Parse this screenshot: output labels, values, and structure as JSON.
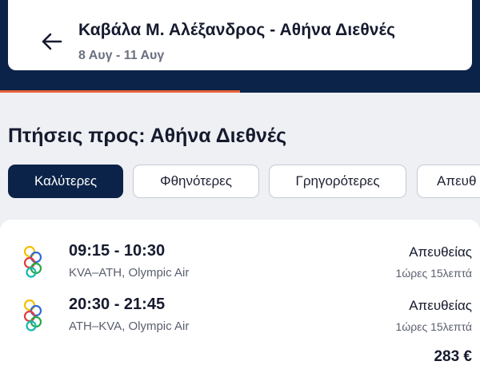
{
  "header": {
    "route_title": "Καβάλα Μ. Αλέξανδρος - Αθήνα Διεθνές",
    "dates": "8 Αυγ - 11 Αυγ",
    "back_icon": "arrow-left-icon"
  },
  "loading_progress": 0.5,
  "colors": {
    "header_bg": "#0b2348",
    "progress_accent": "#e9603a",
    "active_chip_bg": "#0b2348"
  },
  "section_title": "Πτήσεις προς: Αθήνα Διεθνές",
  "sort_chips": [
    {
      "label": "Καλύτερες",
      "active": true
    },
    {
      "label": "Φθηνότερες",
      "active": false
    },
    {
      "label": "Γρηγορότερες",
      "active": false
    },
    {
      "label": "Απευθ",
      "active": false
    }
  ],
  "result": {
    "legs": [
      {
        "times": "09:15 - 10:30",
        "route_airline": "KVA–ATH, Olympic Air",
        "stops": "Απευθείας",
        "duration": "1ώρες 15λεπτά",
        "airline_logo": "olympic-air-rings-logo"
      },
      {
        "times": "20:30 - 21:45",
        "route_airline": "ATH–KVA, Olympic Air",
        "stops": "Απευθείας",
        "duration": "1ώρες 15λεπτά",
        "airline_logo": "olympic-air-rings-logo"
      }
    ],
    "price": "283 €"
  }
}
